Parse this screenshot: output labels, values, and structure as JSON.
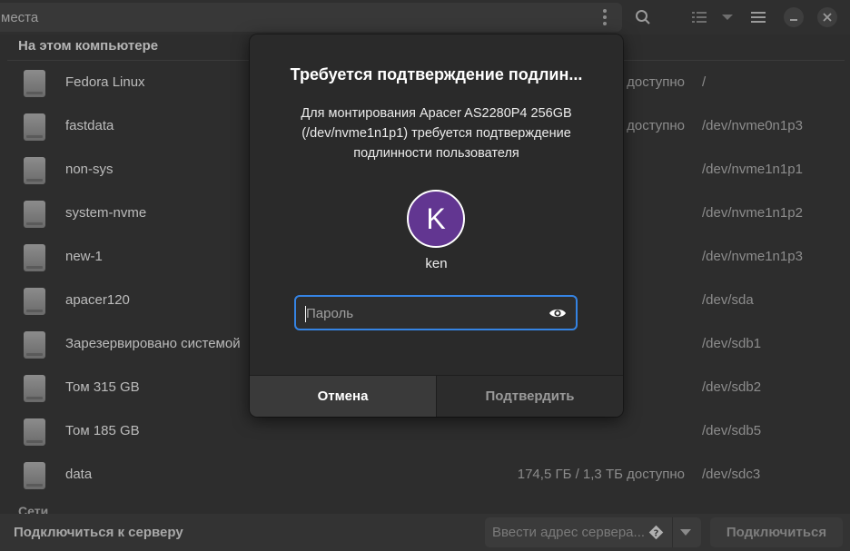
{
  "header": {
    "path_label": "места",
    "icons": [
      "more-vertical-icon",
      "search-icon",
      "list-view-icon",
      "chevron-down-icon",
      "hamburger-menu-icon",
      "minimize-icon",
      "close-icon"
    ]
  },
  "sidebar_section": {
    "title": "На этом компьютере",
    "next_title": "Сети"
  },
  "volumes": [
    {
      "name": "Fedora Linux",
      "avail": "доступно",
      "dev": "/"
    },
    {
      "name": "fastdata",
      "avail": "доступно",
      "dev": "/dev/nvme0n1p3"
    },
    {
      "name": "non-sys",
      "avail": "",
      "dev": "/dev/nvme1n1p1"
    },
    {
      "name": "system-nvme",
      "avail": "",
      "dev": "/dev/nvme1n1p2"
    },
    {
      "name": "new-1",
      "avail": "",
      "dev": "/dev/nvme1n1p3"
    },
    {
      "name": "apacer120",
      "avail": "",
      "dev": "/dev/sda"
    },
    {
      "name": "Зарезервировано системой",
      "avail": "",
      "dev": "/dev/sdb1"
    },
    {
      "name": "Том 315 GB",
      "avail": "",
      "dev": "/dev/sdb2"
    },
    {
      "name": "Том 185 GB",
      "avail": "",
      "dev": "/dev/sdb5"
    },
    {
      "name": "data",
      "avail": "174,5 ГБ / 1,3 ТБ доступно",
      "dev": "/dev/sdc3"
    }
  ],
  "footer": {
    "connect_label": "Подключиться к серверу",
    "server_placeholder": "Ввести адрес сервера...",
    "connect_button": "Подключиться"
  },
  "dialog": {
    "title": "Требуется подтверждение подлин...",
    "message": "Для монтирования Apacer AS2280P4 256GB (/dev/nvme1n1p1) требуется подтверждение подлинности пользователя",
    "avatar_letter": "K",
    "avatar_color": "#623691",
    "username": "ken",
    "password_placeholder": "Пароль",
    "cancel_label": "Отмена",
    "confirm_label": "Подтвердить",
    "accent_color": "#3584e4"
  }
}
